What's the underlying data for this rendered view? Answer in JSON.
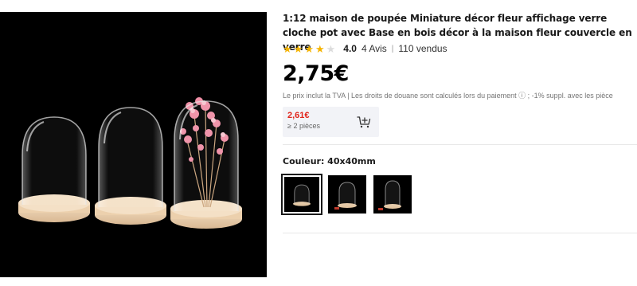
{
  "product": {
    "image_alt": "Trois cloches en verre sur bases en bois",
    "title": "1:12 maison de poupée Miniature décor fleur affichage verre cloche pot avec Base en bois décor à la maison fleur couvercle en verre",
    "rating": {
      "stars_filled": 4,
      "stars_total": 5,
      "value": "4.0",
      "reviews": "4 Avis",
      "separator": "|",
      "sold": "110 vendus"
    },
    "price": "2,75€",
    "tax_note": "Le prix inclut la TVA | Les droits de douane sont calculés lors du paiement ⓘ ; -1% suppl. avec les pièce",
    "bulk": {
      "price": "2,61€",
      "quantity": "≥ 2 pièces",
      "icon": "cart-plus-icon"
    },
    "color": {
      "label": "Couleur: 40x40mm",
      "options_count": 3,
      "selected_index": 0
    }
  },
  "colors": {
    "price": "#000000",
    "bulk_price": "#e1251b",
    "star": "#f5b400",
    "star_empty": "#dcdcdc"
  }
}
